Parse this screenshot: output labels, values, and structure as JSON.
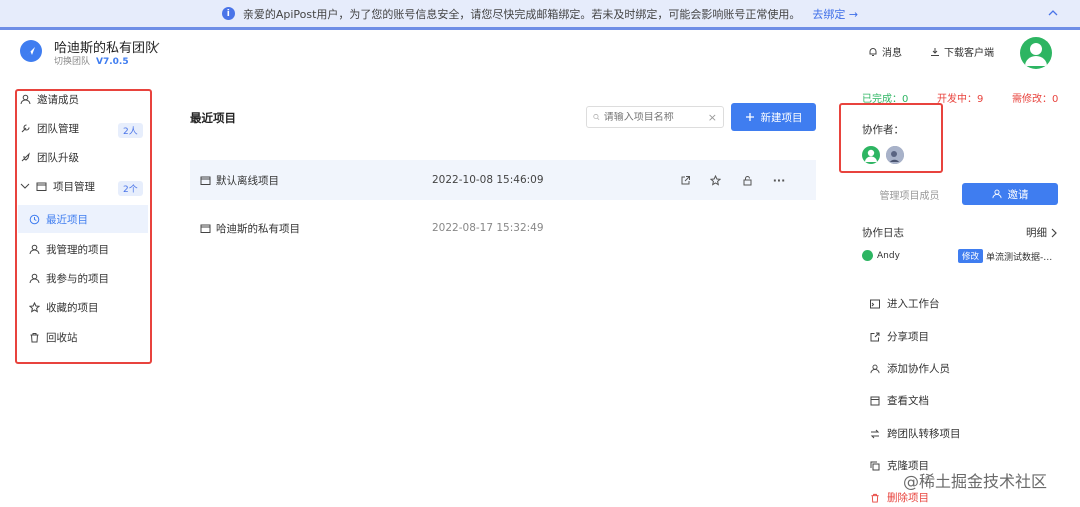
{
  "banner": {
    "message": "亲爱的ApiPost用户，为了您的账号信息安全，请您尽快完成邮箱绑定。若未及时绑定，可能会影响账号正常使用。",
    "link": "去绑定 →"
  },
  "header": {
    "team_name": "哈迪斯的私有团队",
    "switch_team": "切换团队",
    "version": "V7.0.5",
    "messages": "消息",
    "download": "下载客户端"
  },
  "sidebar": {
    "invite": "邀请成员",
    "team_manage": "团队管理",
    "team_manage_badge": "2人",
    "team_upgrade": "团队升级",
    "project_manage": "项目管理",
    "project_manage_badge": "2个",
    "recent": "最近项目",
    "managed": "我管理的项目",
    "joined": "我参与的项目",
    "favorites": "收藏的项目",
    "trash": "回收站"
  },
  "main": {
    "title": "最近项目",
    "search_placeholder": "请输入项目名称",
    "search_clear": "×",
    "new_project": "新建项目",
    "rows": [
      {
        "name": "默认离线项目",
        "date": "2022-10-08 15:46:09"
      },
      {
        "name": "哈迪斯的私有项目",
        "date": "2022-08-17 15:32:49"
      }
    ],
    "row_more": "···"
  },
  "panel": {
    "done": "已完成：0",
    "dev": "开发中：9",
    "change": "需修改：0",
    "collaborators": "协作者：",
    "manage_members": "管理项目成员",
    "invite": "邀请",
    "log_title": "协作日志",
    "log_more": "明细",
    "log_user": "Andy",
    "log_tag": "修改",
    "log_text": "单流测试数据-示例",
    "menu": [
      "进入工作台",
      "分享项目",
      "添加协作人员",
      "查看文档",
      "跨团队转移项目",
      "克隆项目",
      "删除项目"
    ]
  },
  "watermark": "@稀土掘金技术社区",
  "colors": {
    "accent": "#3f7df0",
    "done": "#2db562",
    "dev": "#e8433d",
    "change": "#e8433d",
    "annotation": "#e8433d"
  }
}
